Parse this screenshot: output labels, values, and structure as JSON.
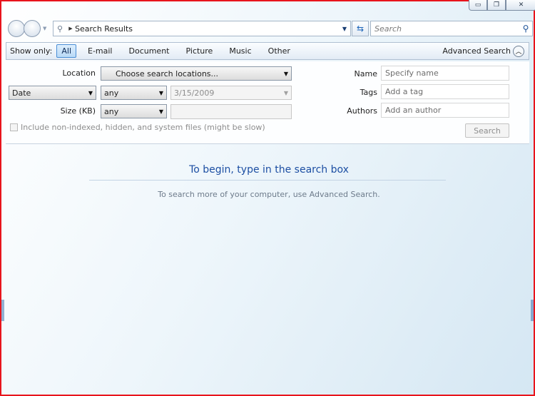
{
  "window": {
    "caption": {
      "minimize": "▭",
      "maximize": "❐",
      "close": "✕"
    }
  },
  "nav": {
    "address_text": "Search Results",
    "search_placeholder": "Search"
  },
  "filterbar": {
    "show_only_label": "Show only:",
    "tabs": [
      "All",
      "E-mail",
      "Document",
      "Picture",
      "Music",
      "Other"
    ],
    "active_tab": "All",
    "advanced_search_label": "Advanced Search"
  },
  "advanced": {
    "location_label": "Location",
    "location_value": "Choose search locations...",
    "date_type": "Date",
    "date_condition": "any",
    "date_value": "3/15/2009",
    "size_label": "Size (KB)",
    "size_condition": "any",
    "size_value": "",
    "include_label": "Include non-indexed, hidden, and system files (might be slow)",
    "name_label": "Name",
    "name_placeholder": "Specify name",
    "tags_label": "Tags",
    "tags_placeholder": "Add a tag",
    "authors_label": "Authors",
    "authors_placeholder": "Add an author",
    "search_button": "Search"
  },
  "main": {
    "headline": "To begin, type in the search box",
    "subline": "To search more of your computer, use Advanced Search."
  },
  "colors": {
    "frame_border": "#e8141c",
    "headline": "#1d4fa3",
    "active_tab_border": "#4a8ed6"
  }
}
